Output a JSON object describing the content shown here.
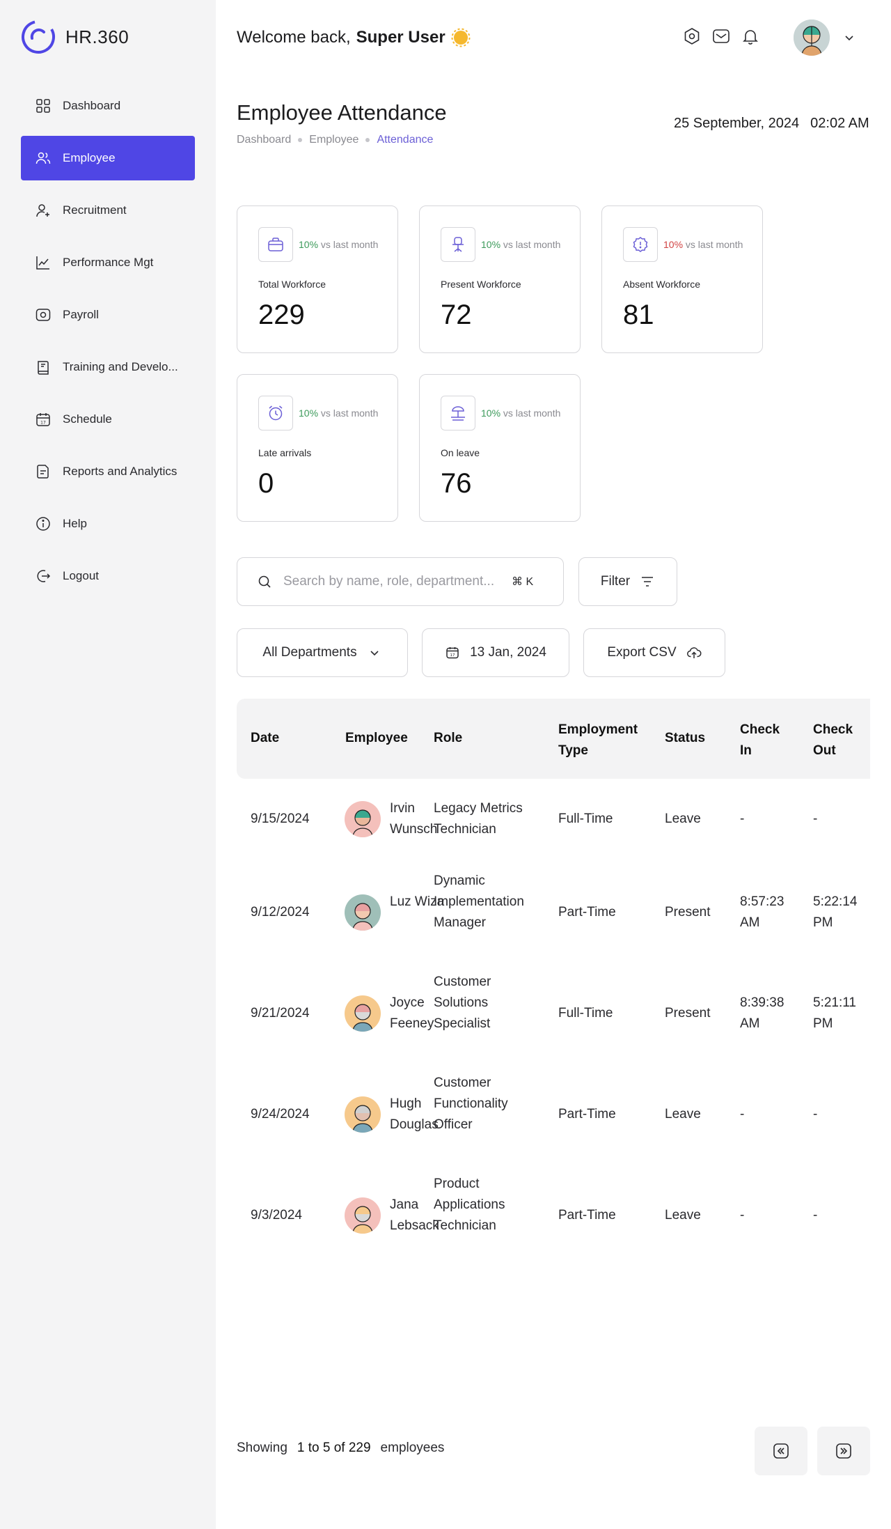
{
  "brand": {
    "name": "HR.360",
    "logo_icon": "hr360-logo"
  },
  "sidebar": {
    "items": [
      {
        "label": "Dashboard",
        "icon": "grid-icon",
        "active": false
      },
      {
        "label": "Employee",
        "icon": "users-icon",
        "active": true
      },
      {
        "label": "Recruitment",
        "icon": "user-plus-icon",
        "active": false
      },
      {
        "label": "Performance Mgt",
        "icon": "chart-line-icon",
        "active": false
      },
      {
        "label": "Payroll",
        "icon": "money-icon",
        "active": false
      },
      {
        "label": "Training and Develo...",
        "icon": "book-icon",
        "active": false
      },
      {
        "label": "Schedule",
        "icon": "calendar-icon",
        "active": false
      },
      {
        "label": "Reports and Analytics",
        "icon": "report-icon",
        "active": false
      },
      {
        "label": "Help",
        "icon": "info-icon",
        "active": false
      },
      {
        "label": "Logout",
        "icon": "logout-icon",
        "active": false
      }
    ],
    "accent": "#4f46e5"
  },
  "header": {
    "welcome_prefix": "Welcome back,",
    "user_name": "Super User",
    "icons": [
      "settings-icon",
      "mail-icon",
      "bell-icon"
    ]
  },
  "page": {
    "title": "Employee Attendance",
    "breadcrumb": [
      "Dashboard",
      "Employee",
      "Attendance"
    ],
    "date": "25 September, 2024",
    "time": "02:02 AM"
  },
  "stats": [
    {
      "label": "Total Workforce",
      "value": "229",
      "change": "10%",
      "change_text": "vs last month",
      "trend": "up",
      "icon": "briefcase-icon"
    },
    {
      "label": "Present Workforce",
      "value": "72",
      "change": "10%",
      "change_text": "vs last month",
      "trend": "up",
      "icon": "office-chair-icon"
    },
    {
      "label": "Absent Workforce",
      "value": "81",
      "change": "10%",
      "change_text": "vs last month",
      "trend": "down",
      "icon": "alert-badge-icon"
    },
    {
      "label": "Late arrivals",
      "value": "0",
      "change": "10%",
      "change_text": "vs last month",
      "trend": "up",
      "icon": "alarm-clock-icon"
    },
    {
      "label": "On leave",
      "value": "76",
      "change": "10%",
      "change_text": "vs last month",
      "trend": "up",
      "icon": "beach-umbrella-icon"
    }
  ],
  "search": {
    "placeholder": "Search by name, role, department...",
    "value": "",
    "shortcut": "⌘ K"
  },
  "filter_label": "Filter",
  "department_select": "All Departments",
  "date_picker": "13 Jan, 2024",
  "export_label": "Export CSV",
  "table": {
    "columns": [
      "Date",
      "Employee",
      "Role",
      "Employment Type",
      "Status",
      "Check In",
      "Check Out"
    ],
    "rows": [
      {
        "date": "9/15/2024",
        "employee": "Irvin Wunsch",
        "role": "Legacy Metrics Technician",
        "type": "Full-Time",
        "status": "Leave",
        "check_in": "-",
        "check_out": "-"
      },
      {
        "date": "9/12/2024",
        "employee": "Luz Wiza",
        "role": "Dynamic Implementation Manager",
        "type": "Part-Time",
        "status": "Present",
        "check_in": "8:57:23 AM",
        "check_out": "5:22:14 PM"
      },
      {
        "date": "9/21/2024",
        "employee": "Joyce Feeney",
        "role": "Customer Solutions Specialist",
        "type": "Full-Time",
        "status": "Present",
        "check_in": "8:39:38 AM",
        "check_out": "5:21:11 PM"
      },
      {
        "date": "9/24/2024",
        "employee": "Hugh Douglas",
        "role": "Customer Functionality Officer",
        "type": "Part-Time",
        "status": "Leave",
        "check_in": "-",
        "check_out": "-"
      },
      {
        "date": "9/3/2024",
        "employee": "Jana Lebsack",
        "role": "Product Applications Technician",
        "type": "Part-Time",
        "status": "Leave",
        "check_in": "-",
        "check_out": "-"
      }
    ]
  },
  "pagination": {
    "prefix": "Showing",
    "range": "1 to 5 of 229",
    "suffix": "employees"
  }
}
